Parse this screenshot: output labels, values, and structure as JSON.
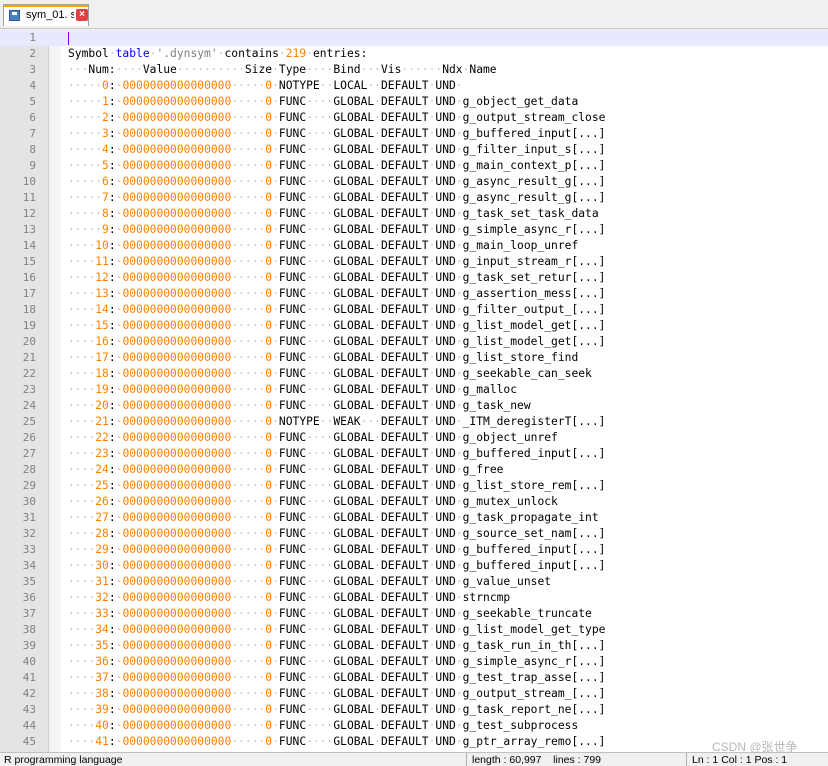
{
  "tab": {
    "title": "sym_01. s",
    "icon": "save-disk-icon",
    "close_glyph": "×"
  },
  "editor": {
    "first_line": "",
    "summary": {
      "prefix": "Symbol",
      "table_word": "table",
      "section": "'.dynsym'",
      "contains_word": "contains",
      "count": "219",
      "entries_word": "entries:"
    },
    "header": {
      "num": "Num:",
      "value": "Value",
      "size": "Size",
      "type": "Type",
      "bind": "Bind",
      "vis": "Vis",
      "ndx": "Ndx",
      "name": "Name"
    },
    "symbols": [
      {
        "num": "0",
        "value": "0000000000000000",
        "size": "0",
        "type": "NOTYPE",
        "bind": "LOCAL",
        "vis": "DEFAULT",
        "ndx": "UND",
        "name": ""
      },
      {
        "num": "1",
        "value": "0000000000000000",
        "size": "0",
        "type": "FUNC",
        "bind": "GLOBAL",
        "vis": "DEFAULT",
        "ndx": "UND",
        "name": "g_object_get_data"
      },
      {
        "num": "2",
        "value": "0000000000000000",
        "size": "0",
        "type": "FUNC",
        "bind": "GLOBAL",
        "vis": "DEFAULT",
        "ndx": "UND",
        "name": "g_output_stream_close"
      },
      {
        "num": "3",
        "value": "0000000000000000",
        "size": "0",
        "type": "FUNC",
        "bind": "GLOBAL",
        "vis": "DEFAULT",
        "ndx": "UND",
        "name": "g_buffered_input[...]"
      },
      {
        "num": "4",
        "value": "0000000000000000",
        "size": "0",
        "type": "FUNC",
        "bind": "GLOBAL",
        "vis": "DEFAULT",
        "ndx": "UND",
        "name": "g_filter_input_s[...]"
      },
      {
        "num": "5",
        "value": "0000000000000000",
        "size": "0",
        "type": "FUNC",
        "bind": "GLOBAL",
        "vis": "DEFAULT",
        "ndx": "UND",
        "name": "g_main_context_p[...]"
      },
      {
        "num": "6",
        "value": "0000000000000000",
        "size": "0",
        "type": "FUNC",
        "bind": "GLOBAL",
        "vis": "DEFAULT",
        "ndx": "UND",
        "name": "g_async_result_g[...]"
      },
      {
        "num": "7",
        "value": "0000000000000000",
        "size": "0",
        "type": "FUNC",
        "bind": "GLOBAL",
        "vis": "DEFAULT",
        "ndx": "UND",
        "name": "g_async_result_g[...]"
      },
      {
        "num": "8",
        "value": "0000000000000000",
        "size": "0",
        "type": "FUNC",
        "bind": "GLOBAL",
        "vis": "DEFAULT",
        "ndx": "UND",
        "name": "g_task_set_task_data"
      },
      {
        "num": "9",
        "value": "0000000000000000",
        "size": "0",
        "type": "FUNC",
        "bind": "GLOBAL",
        "vis": "DEFAULT",
        "ndx": "UND",
        "name": "g_simple_async_r[...]"
      },
      {
        "num": "10",
        "value": "0000000000000000",
        "size": "0",
        "type": "FUNC",
        "bind": "GLOBAL",
        "vis": "DEFAULT",
        "ndx": "UND",
        "name": "g_main_loop_unref"
      },
      {
        "num": "11",
        "value": "0000000000000000",
        "size": "0",
        "type": "FUNC",
        "bind": "GLOBAL",
        "vis": "DEFAULT",
        "ndx": "UND",
        "name": "g_input_stream_r[...]"
      },
      {
        "num": "12",
        "value": "0000000000000000",
        "size": "0",
        "type": "FUNC",
        "bind": "GLOBAL",
        "vis": "DEFAULT",
        "ndx": "UND",
        "name": "g_task_set_retur[...]"
      },
      {
        "num": "13",
        "value": "0000000000000000",
        "size": "0",
        "type": "FUNC",
        "bind": "GLOBAL",
        "vis": "DEFAULT",
        "ndx": "UND",
        "name": "g_assertion_mess[...]"
      },
      {
        "num": "14",
        "value": "0000000000000000",
        "size": "0",
        "type": "FUNC",
        "bind": "GLOBAL",
        "vis": "DEFAULT",
        "ndx": "UND",
        "name": "g_filter_output_[...]"
      },
      {
        "num": "15",
        "value": "0000000000000000",
        "size": "0",
        "type": "FUNC",
        "bind": "GLOBAL",
        "vis": "DEFAULT",
        "ndx": "UND",
        "name": "g_list_model_get[...]"
      },
      {
        "num": "16",
        "value": "0000000000000000",
        "size": "0",
        "type": "FUNC",
        "bind": "GLOBAL",
        "vis": "DEFAULT",
        "ndx": "UND",
        "name": "g_list_model_get[...]"
      },
      {
        "num": "17",
        "value": "0000000000000000",
        "size": "0",
        "type": "FUNC",
        "bind": "GLOBAL",
        "vis": "DEFAULT",
        "ndx": "UND",
        "name": "g_list_store_find"
      },
      {
        "num": "18",
        "value": "0000000000000000",
        "size": "0",
        "type": "FUNC",
        "bind": "GLOBAL",
        "vis": "DEFAULT",
        "ndx": "UND",
        "name": "g_seekable_can_seek"
      },
      {
        "num": "19",
        "value": "0000000000000000",
        "size": "0",
        "type": "FUNC",
        "bind": "GLOBAL",
        "vis": "DEFAULT",
        "ndx": "UND",
        "name": "g_malloc"
      },
      {
        "num": "20",
        "value": "0000000000000000",
        "size": "0",
        "type": "FUNC",
        "bind": "GLOBAL",
        "vis": "DEFAULT",
        "ndx": "UND",
        "name": "g_task_new"
      },
      {
        "num": "21",
        "value": "0000000000000000",
        "size": "0",
        "type": "NOTYPE",
        "bind": "WEAK",
        "vis": "DEFAULT",
        "ndx": "UND",
        "name": "_ITM_deregisterT[...]"
      },
      {
        "num": "22",
        "value": "0000000000000000",
        "size": "0",
        "type": "FUNC",
        "bind": "GLOBAL",
        "vis": "DEFAULT",
        "ndx": "UND",
        "name": "g_object_unref"
      },
      {
        "num": "23",
        "value": "0000000000000000",
        "size": "0",
        "type": "FUNC",
        "bind": "GLOBAL",
        "vis": "DEFAULT",
        "ndx": "UND",
        "name": "g_buffered_input[...]"
      },
      {
        "num": "24",
        "value": "0000000000000000",
        "size": "0",
        "type": "FUNC",
        "bind": "GLOBAL",
        "vis": "DEFAULT",
        "ndx": "UND",
        "name": "g_free"
      },
      {
        "num": "25",
        "value": "0000000000000000",
        "size": "0",
        "type": "FUNC",
        "bind": "GLOBAL",
        "vis": "DEFAULT",
        "ndx": "UND",
        "name": "g_list_store_rem[...]"
      },
      {
        "num": "26",
        "value": "0000000000000000",
        "size": "0",
        "type": "FUNC",
        "bind": "GLOBAL",
        "vis": "DEFAULT",
        "ndx": "UND",
        "name": "g_mutex_unlock"
      },
      {
        "num": "27",
        "value": "0000000000000000",
        "size": "0",
        "type": "FUNC",
        "bind": "GLOBAL",
        "vis": "DEFAULT",
        "ndx": "UND",
        "name": "g_task_propagate_int"
      },
      {
        "num": "28",
        "value": "0000000000000000",
        "size": "0",
        "type": "FUNC",
        "bind": "GLOBAL",
        "vis": "DEFAULT",
        "ndx": "UND",
        "name": "g_source_set_nam[...]"
      },
      {
        "num": "29",
        "value": "0000000000000000",
        "size": "0",
        "type": "FUNC",
        "bind": "GLOBAL",
        "vis": "DEFAULT",
        "ndx": "UND",
        "name": "g_buffered_input[...]"
      },
      {
        "num": "30",
        "value": "0000000000000000",
        "size": "0",
        "type": "FUNC",
        "bind": "GLOBAL",
        "vis": "DEFAULT",
        "ndx": "UND",
        "name": "g_buffered_input[...]"
      },
      {
        "num": "31",
        "value": "0000000000000000",
        "size": "0",
        "type": "FUNC",
        "bind": "GLOBAL",
        "vis": "DEFAULT",
        "ndx": "UND",
        "name": "g_value_unset"
      },
      {
        "num": "32",
        "value": "0000000000000000",
        "size": "0",
        "type": "FUNC",
        "bind": "GLOBAL",
        "vis": "DEFAULT",
        "ndx": "UND",
        "name": "strncmp"
      },
      {
        "num": "33",
        "value": "0000000000000000",
        "size": "0",
        "type": "FUNC",
        "bind": "GLOBAL",
        "vis": "DEFAULT",
        "ndx": "UND",
        "name": "g_seekable_truncate"
      },
      {
        "num": "34",
        "value": "0000000000000000",
        "size": "0",
        "type": "FUNC",
        "bind": "GLOBAL",
        "vis": "DEFAULT",
        "ndx": "UND",
        "name": "g_list_model_get_type"
      },
      {
        "num": "35",
        "value": "0000000000000000",
        "size": "0",
        "type": "FUNC",
        "bind": "GLOBAL",
        "vis": "DEFAULT",
        "ndx": "UND",
        "name": "g_task_run_in_th[...]"
      },
      {
        "num": "36",
        "value": "0000000000000000",
        "size": "0",
        "type": "FUNC",
        "bind": "GLOBAL",
        "vis": "DEFAULT",
        "ndx": "UND",
        "name": "g_simple_async_r[...]"
      },
      {
        "num": "37",
        "value": "0000000000000000",
        "size": "0",
        "type": "FUNC",
        "bind": "GLOBAL",
        "vis": "DEFAULT",
        "ndx": "UND",
        "name": "g_test_trap_asse[...]"
      },
      {
        "num": "38",
        "value": "0000000000000000",
        "size": "0",
        "type": "FUNC",
        "bind": "GLOBAL",
        "vis": "DEFAULT",
        "ndx": "UND",
        "name": "g_output_stream_[...]"
      },
      {
        "num": "39",
        "value": "0000000000000000",
        "size": "0",
        "type": "FUNC",
        "bind": "GLOBAL",
        "vis": "DEFAULT",
        "ndx": "UND",
        "name": "g_task_report_ne[...]"
      },
      {
        "num": "40",
        "value": "0000000000000000",
        "size": "0",
        "type": "FUNC",
        "bind": "GLOBAL",
        "vis": "DEFAULT",
        "ndx": "UND",
        "name": "g_test_subprocess"
      },
      {
        "num": "41",
        "value": "0000000000000000",
        "size": "0",
        "type": "FUNC",
        "bind": "GLOBAL",
        "vis": "DEFAULT",
        "ndx": "UND",
        "name": "g_ptr_array_remo[...]"
      }
    ]
  },
  "status": {
    "language": "R programming language",
    "length": "length : 60,997",
    "lines": "lines : 799",
    "position": "Ln : 1    Col : 1    Pos : 1"
  },
  "watermark": "CSDN @张世争",
  "colors": {
    "number": "#ff8000",
    "whitespace_dot": "#c0c0c0",
    "keyword": "#0000ff",
    "string": "#808080",
    "caret": "#8000ff",
    "tab_accent": "#ffa500"
  }
}
